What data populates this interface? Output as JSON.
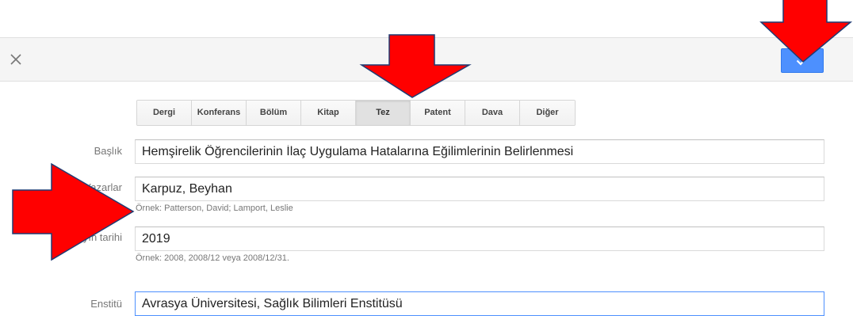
{
  "toolbar": {
    "close_icon": "close-icon",
    "save_icon": "check-icon",
    "accent_color": "#4d90fe"
  },
  "types": {
    "items": [
      "Dergi",
      "Konferans",
      "Bölüm",
      "Kitap",
      "Tez",
      "Patent",
      "Dava",
      "Diğer"
    ],
    "selected": "Tez"
  },
  "form": {
    "title_label": "Başlık",
    "title_value": "Hemşirelik Öğrencilerinin İlaç Uygulama Hatalarına Eğilimlerinin Belirlenmesi",
    "authors_label": "Yazarlar",
    "authors_value": "Karpuz, Beyhan",
    "authors_hint": "Örnek: Patterson, David; Lamport, Leslie",
    "date_label": "Yayın tarihi",
    "date_value": "2019",
    "date_hint": "Örnek: 2008, 2008/12 veya 2008/12/31.",
    "institution_label": "Enstitü",
    "institution_value": "Avrasya Üniversitesi, Sağlık Bilimleri Enstitüsü"
  },
  "annotations": {
    "arrow_color": "#ff0000",
    "arrow_count": 3
  }
}
